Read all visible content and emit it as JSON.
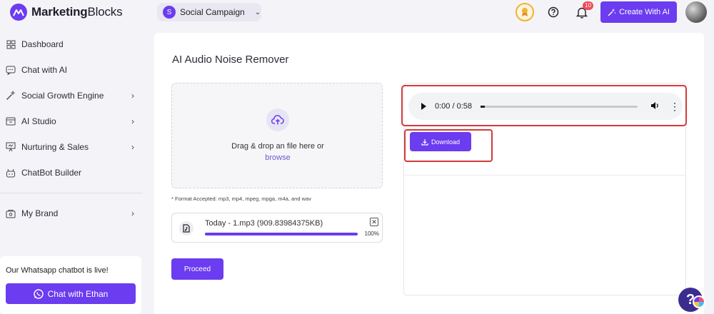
{
  "brand": {
    "name_bold": "Marketing",
    "name_rest": "Blocks"
  },
  "campaign": {
    "badge": "S",
    "name": "Social Campaign"
  },
  "topbar": {
    "notification_count": "10",
    "create_ai_label": "Create With AI"
  },
  "sidebar": {
    "items": [
      {
        "label": "Dashboard",
        "icon": "grid-icon",
        "chevron": false
      },
      {
        "label": "Chat with AI",
        "icon": "chat-icon",
        "chevron": false
      },
      {
        "label": "Social Growth Engine",
        "icon": "magic-wand-icon",
        "chevron": true
      },
      {
        "label": "AI Studio",
        "icon": "inbox-icon",
        "chevron": true
      },
      {
        "label": "Nurturing & Sales",
        "icon": "presentation-icon",
        "chevron": true
      },
      {
        "label": "ChatBot Builder",
        "icon": "bot-icon",
        "chevron": false
      }
    ],
    "brand_item": {
      "label": "My Brand",
      "icon": "brand-icon",
      "chevron": true
    }
  },
  "whatsapp": {
    "text": "Our Whatsapp chatbot is live!",
    "button_label": "Chat with Ethan"
  },
  "main": {
    "title": "AI Audio Noise Remover",
    "dropzone": {
      "text": "Drag & drop an file here or",
      "browse": "browse"
    },
    "format_note": "* Format Accepted: mp3, mp4, mpeg, mpga, m4a, and wav",
    "file": {
      "name": "Today - 1.mp3 (909.83984375KB)",
      "progress_percent": 100,
      "progress_label": "100%"
    },
    "proceed_label": "Proceed",
    "audio": {
      "time": "0:00 / 0:58"
    },
    "download_label": "Download"
  },
  "colors": {
    "accent": "#6b3cf0",
    "highlight": "#d33a3a"
  }
}
